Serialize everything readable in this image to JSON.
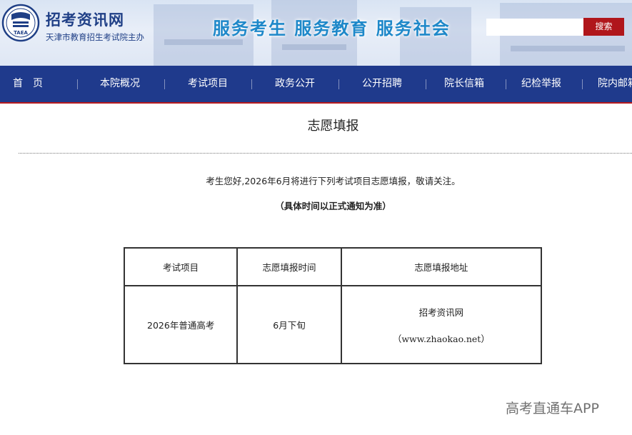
{
  "header": {
    "site_title": "招考资讯网",
    "site_subtitle": "天津市教育招生考试院主办",
    "logo_text": "TAEA",
    "slogan": "服务考生  服务教育  服务社会",
    "search": {
      "placeholder": "",
      "value": "",
      "button_label": "搜索"
    }
  },
  "nav": {
    "items": [
      "首　页",
      "本院概况",
      "考试项目",
      "政务公开",
      "公开招聘",
      "院长信箱",
      "纪检举报",
      "院内邮箱"
    ]
  },
  "main": {
    "title": "志愿填报",
    "notice": "考生您好,2026年6月将进行下列考试项目志愿填报，敬请关注。",
    "subnotice": "（具体时间以正式通知为准）",
    "table": {
      "headers": [
        "考试项目",
        "志愿填报时间",
        "志愿填报地址"
      ],
      "rows": [
        {
          "exam": "2026年普通高考",
          "time": "6月下旬",
          "address_name": "招考资讯网",
          "address_url": "（www.zhaokao.net）"
        }
      ]
    }
  },
  "watermark": "高考直通车APP",
  "colors": {
    "nav_bg": "#1f3a8c",
    "nav_border": "#b51a1f",
    "search_button": "#b0161b",
    "title_blue": "#1f3f86",
    "slogan_blue": "#1e88c9"
  }
}
